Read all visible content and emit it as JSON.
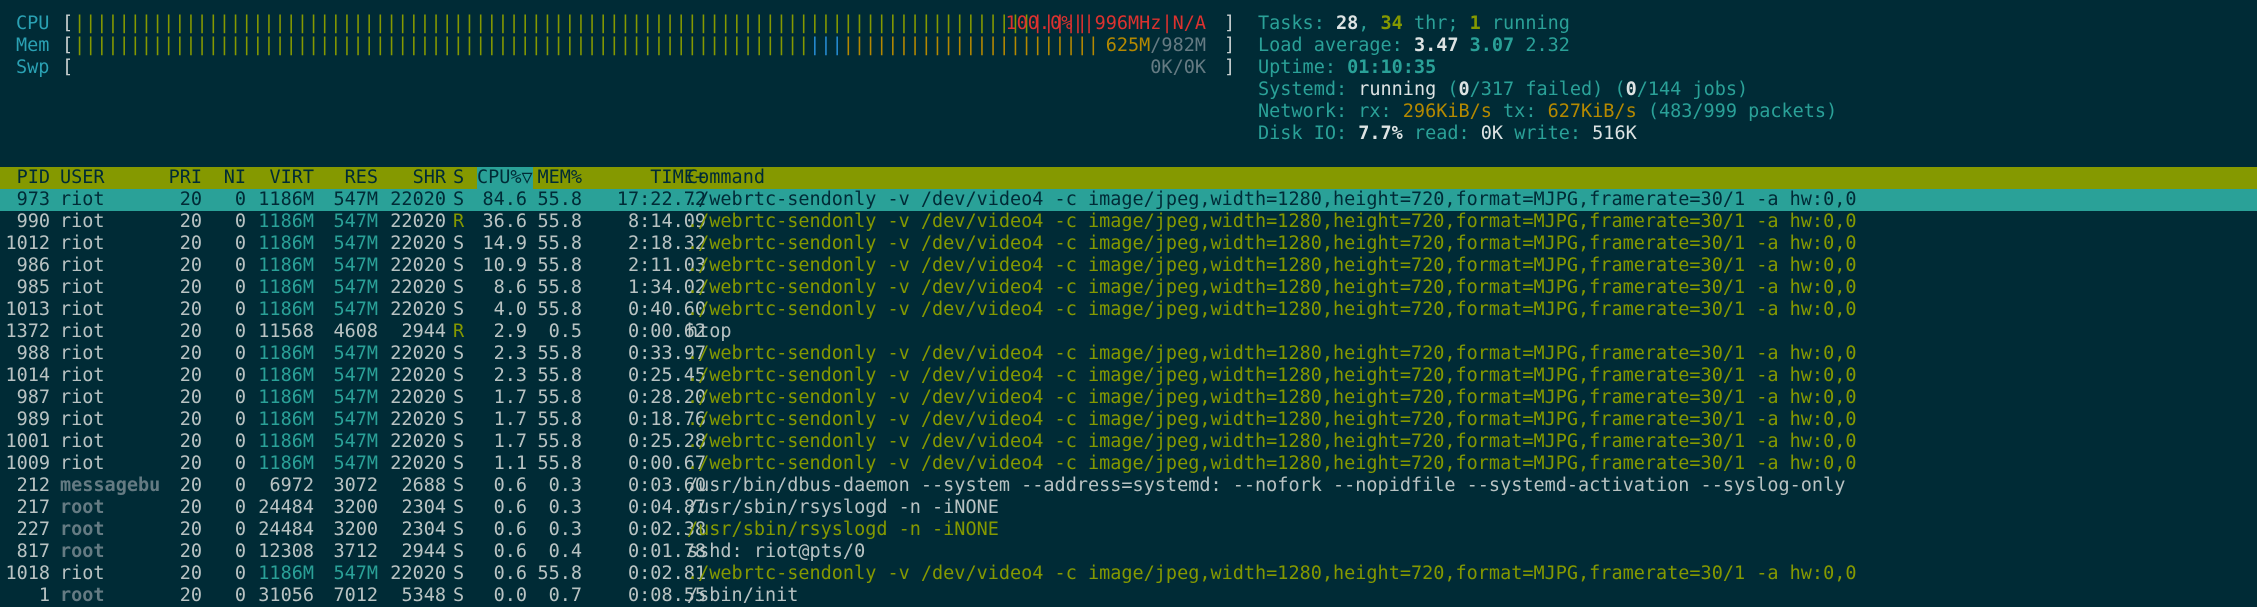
{
  "meters": {
    "cpu": {
      "label": "CPU",
      "text": "100.0%||996MHz|N/A",
      "open": "[",
      "close": "]",
      "level": 1.0
    },
    "mem": {
      "label": "Mem",
      "text": "625M/982M",
      "open": "[",
      "close": "]",
      "used_fraction": 0.637
    },
    "swp": {
      "label": "Swp",
      "text": "0K/0K",
      "open": "[",
      "close": "]",
      "level": 0
    }
  },
  "info": {
    "tasks_label": "Tasks: ",
    "tasks": "28",
    "threads_sep": ", ",
    "threads": "34",
    "threads_label": " thr; ",
    "running": "1",
    "running_label": " running",
    "load_label": "Load average: ",
    "load1": "3.47",
    "load5": "3.07",
    "load15": "2.32",
    "uptime_label": "Uptime: ",
    "uptime": "01:10:35",
    "systemd_label": "Systemd: ",
    "systemd_state": "running",
    "systemd_open": " (",
    "failed": "0",
    "failed_total": "/317",
    "failed_label": " failed) (",
    "jobs": "0",
    "jobs_total": "/144",
    "jobs_label": " jobs)",
    "net_label": "Network: rx: ",
    "rx": "296KiB/s",
    "tx_label": " tx: ",
    "tx": "627KiB/s",
    "packets": " (483/999 packets)",
    "disk_label": "Disk IO: ",
    "disk_pct": "7.7%",
    "read_label": " read: ",
    "read": "0K",
    "write_label": " write: ",
    "write": "516K"
  },
  "columns": [
    "PID",
    "USER",
    "PRI",
    "NI",
    "VIRT",
    "RES",
    "SHR",
    "S",
    "CPU%▽",
    "MEM%",
    "TIME+",
    "Command"
  ],
  "processes": [
    {
      "pid": "973",
      "user": "riot",
      "pri": "20",
      "ni": "0",
      "virt": "1186M",
      "res": "547M",
      "shr": "22020",
      "s": "S",
      "cpu": "84.6",
      "mem": "55.8",
      "time": "17:22.72",
      "cmd": "./webrtc-sendonly -v /dev/video4 -c image/jpeg,width=1280,height=720,format=MJPG,framerate=30/1 -a hw:0,0"
    },
    {
      "pid": "990",
      "user": "riot",
      "pri": "20",
      "ni": "0",
      "virt": "1186M",
      "res": "547M",
      "shr": "22020",
      "s": "R",
      "cpu": "36.6",
      "mem": "55.8",
      "time": "8:14.09",
      "cmd": "./webrtc-sendonly -v /dev/video4 -c image/jpeg,width=1280,height=720,format=MJPG,framerate=30/1 -a hw:0,0"
    },
    {
      "pid": "1012",
      "user": "riot",
      "pri": "20",
      "ni": "0",
      "virt": "1186M",
      "res": "547M",
      "shr": "22020",
      "s": "S",
      "cpu": "14.9",
      "mem": "55.8",
      "time": "2:18.32",
      "cmd": "./webrtc-sendonly -v /dev/video4 -c image/jpeg,width=1280,height=720,format=MJPG,framerate=30/1 -a hw:0,0"
    },
    {
      "pid": "986",
      "user": "riot",
      "pri": "20",
      "ni": "0",
      "virt": "1186M",
      "res": "547M",
      "shr": "22020",
      "s": "S",
      "cpu": "10.9",
      "mem": "55.8",
      "time": "2:11.03",
      "cmd": "./webrtc-sendonly -v /dev/video4 -c image/jpeg,width=1280,height=720,format=MJPG,framerate=30/1 -a hw:0,0"
    },
    {
      "pid": "985",
      "user": "riot",
      "pri": "20",
      "ni": "0",
      "virt": "1186M",
      "res": "547M",
      "shr": "22020",
      "s": "S",
      "cpu": "8.6",
      "mem": "55.8",
      "time": "1:34.02",
      "cmd": "./webrtc-sendonly -v /dev/video4 -c image/jpeg,width=1280,height=720,format=MJPG,framerate=30/1 -a hw:0,0"
    },
    {
      "pid": "1013",
      "user": "riot",
      "pri": "20",
      "ni": "0",
      "virt": "1186M",
      "res": "547M",
      "shr": "22020",
      "s": "S",
      "cpu": "4.0",
      "mem": "55.8",
      "time": "0:40.60",
      "cmd": "./webrtc-sendonly -v /dev/video4 -c image/jpeg,width=1280,height=720,format=MJPG,framerate=30/1 -a hw:0,0"
    },
    {
      "pid": "1372",
      "user": "riot",
      "pri": "20",
      "ni": "0",
      "virt": "11568",
      "res": "4608",
      "shr": "2944",
      "s": "R",
      "cpu": "2.9",
      "mem": "0.5",
      "time": "0:00.62",
      "cmd": "htop"
    },
    {
      "pid": "988",
      "user": "riot",
      "pri": "20",
      "ni": "0",
      "virt": "1186M",
      "res": "547M",
      "shr": "22020",
      "s": "S",
      "cpu": "2.3",
      "mem": "55.8",
      "time": "0:33.97",
      "cmd": "./webrtc-sendonly -v /dev/video4 -c image/jpeg,width=1280,height=720,format=MJPG,framerate=30/1 -a hw:0,0"
    },
    {
      "pid": "1014",
      "user": "riot",
      "pri": "20",
      "ni": "0",
      "virt": "1186M",
      "res": "547M",
      "shr": "22020",
      "s": "S",
      "cpu": "2.3",
      "mem": "55.8",
      "time": "0:25.45",
      "cmd": "./webrtc-sendonly -v /dev/video4 -c image/jpeg,width=1280,height=720,format=MJPG,framerate=30/1 -a hw:0,0"
    },
    {
      "pid": "987",
      "user": "riot",
      "pri": "20",
      "ni": "0",
      "virt": "1186M",
      "res": "547M",
      "shr": "22020",
      "s": "S",
      "cpu": "1.7",
      "mem": "55.8",
      "time": "0:28.20",
      "cmd": "./webrtc-sendonly -v /dev/video4 -c image/jpeg,width=1280,height=720,format=MJPG,framerate=30/1 -a hw:0,0"
    },
    {
      "pid": "989",
      "user": "riot",
      "pri": "20",
      "ni": "0",
      "virt": "1186M",
      "res": "547M",
      "shr": "22020",
      "s": "S",
      "cpu": "1.7",
      "mem": "55.8",
      "time": "0:18.76",
      "cmd": "./webrtc-sendonly -v /dev/video4 -c image/jpeg,width=1280,height=720,format=MJPG,framerate=30/1 -a hw:0,0"
    },
    {
      "pid": "1001",
      "user": "riot",
      "pri": "20",
      "ni": "0",
      "virt": "1186M",
      "res": "547M",
      "shr": "22020",
      "s": "S",
      "cpu": "1.7",
      "mem": "55.8",
      "time": "0:25.28",
      "cmd": "./webrtc-sendonly -v /dev/video4 -c image/jpeg,width=1280,height=720,format=MJPG,framerate=30/1 -a hw:0,0"
    },
    {
      "pid": "1009",
      "user": "riot",
      "pri": "20",
      "ni": "0",
      "virt": "1186M",
      "res": "547M",
      "shr": "22020",
      "s": "S",
      "cpu": "1.1",
      "mem": "55.8",
      "time": "0:00.67",
      "cmd": "./webrtc-sendonly -v /dev/video4 -c image/jpeg,width=1280,height=720,format=MJPG,framerate=30/1 -a hw:0,0"
    },
    {
      "pid": "212",
      "user": "messagebu",
      "pri": "20",
      "ni": "0",
      "virt": "6972",
      "res": "3072",
      "shr": "2688",
      "s": "S",
      "cpu": "0.6",
      "mem": "0.3",
      "time": "0:03.60",
      "cmd": "/usr/bin/dbus-daemon --system --address=systemd: --nofork --nopidfile --systemd-activation --syslog-only"
    },
    {
      "pid": "217",
      "user": "root",
      "pri": "20",
      "ni": "0",
      "virt": "24484",
      "res": "3200",
      "shr": "2304",
      "s": "S",
      "cpu": "0.6",
      "mem": "0.3",
      "time": "0:04.87",
      "cmd": "/usr/sbin/rsyslogd -n -iNONE"
    },
    {
      "pid": "227",
      "user": "root",
      "pri": "20",
      "ni": "0",
      "virt": "24484",
      "res": "3200",
      "shr": "2304",
      "s": "S",
      "cpu": "0.6",
      "mem": "0.3",
      "time": "0:02.38",
      "cmd": "/usr/sbin/rsyslogd -n -iNONE"
    },
    {
      "pid": "817",
      "user": "root",
      "pri": "20",
      "ni": "0",
      "virt": "12308",
      "res": "3712",
      "shr": "2944",
      "s": "S",
      "cpu": "0.6",
      "mem": "0.4",
      "time": "0:01.78",
      "cmd": "sshd: riot@pts/0"
    },
    {
      "pid": "1018",
      "user": "riot",
      "pri": "20",
      "ni": "0",
      "virt": "1186M",
      "res": "547M",
      "shr": "22020",
      "s": "S",
      "cpu": "0.6",
      "mem": "55.8",
      "time": "0:02.81",
      "cmd": "./webrtc-sendonly -v /dev/video4 -c image/jpeg,width=1280,height=720,format=MJPG,framerate=30/1 -a hw:0,0"
    },
    {
      "pid": "1",
      "user": "root",
      "pri": "20",
      "ni": "0",
      "virt": "31056",
      "res": "7012",
      "shr": "5348",
      "s": "S",
      "cpu": "0.0",
      "mem": "0.7",
      "time": "0:08.55",
      "cmd": "/sbin/init"
    }
  ],
  "colors": {
    "bg": "#002b36",
    "header": "#859900",
    "selected": "#2aa198",
    "green": "#859900",
    "red": "#dc322f",
    "blue": "#268bd2",
    "yellow": "#b58900",
    "cyan": "#2aa198"
  }
}
